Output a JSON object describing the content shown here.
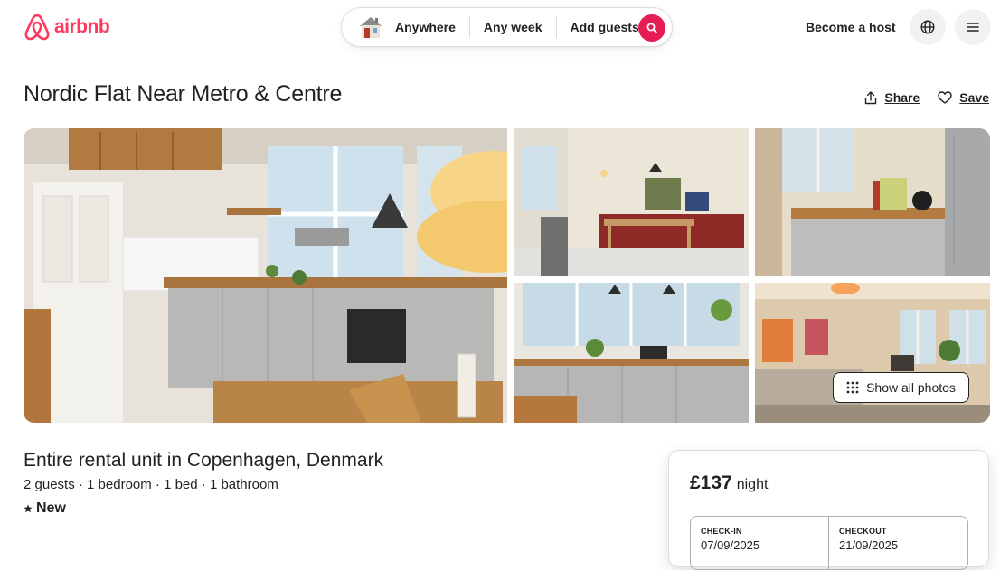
{
  "header": {
    "brand": "airbnb",
    "search": {
      "where": "Anywhere",
      "when": "Any week",
      "who": "Add guests"
    },
    "become_host": "Become a host"
  },
  "listing": {
    "title": "Nordic Flat Near Metro & Centre",
    "share_label": "Share",
    "save_label": "Save",
    "show_all_photos": "Show all photos",
    "type": "Entire rental unit in Copenhagen, Denmark",
    "details": "2 guests · 1 bedroom · 1 bed · 1 bathroom",
    "badge": "New"
  },
  "booking": {
    "price": "£137",
    "unit": "night",
    "checkin_label": "CHECK-IN",
    "checkin_value": "07/09/2025",
    "checkout_label": "CHECKOUT",
    "checkout_value": "21/09/2025"
  },
  "colors": {
    "brand": "#ff385c",
    "search_button": "#e51d53"
  },
  "icons": [
    "airbnb-logo-icon",
    "house-icon",
    "search-icon",
    "globe-icon",
    "menu-icon",
    "share-icon",
    "heart-icon",
    "grid-dots-icon",
    "star-icon"
  ]
}
